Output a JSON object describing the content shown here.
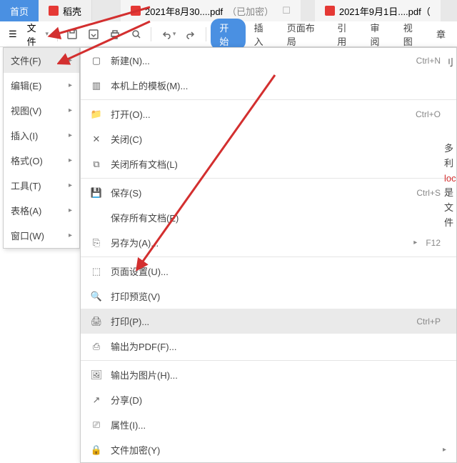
{
  "tabs": {
    "home": "首页",
    "dockshell": "稻壳",
    "pdf1": "2021年8月30....pdf",
    "pdf1_suffix": "（已加密）",
    "pdf2": "2021年9月1日....pdf（"
  },
  "toolbar": {
    "file": "文件",
    "start": "开始",
    "insert": "插入",
    "layout": "页面布局",
    "reference": "引用",
    "review": "审阅",
    "view": "视图",
    "chapter": "章"
  },
  "side": {
    "file": "文件(F)",
    "edit": "编辑(E)",
    "view": "视图(V)",
    "insert": "插入(I)",
    "format": "格式(O)",
    "tools": "工具(T)",
    "table": "表格(A)",
    "window": "窗口(W)"
  },
  "sub": {
    "new": "新建(N)...",
    "template": "本机上的模板(M)...",
    "open": "打开(O)...",
    "close": "关闭(C)",
    "close_all": "关闭所有文档(L)",
    "save": "保存(S)",
    "save_all": "保存所有文档(E)",
    "save_as": "另存为(A)...",
    "page_setup": "页面设置(U)...",
    "print_preview": "打印预览(V)",
    "print": "打印(P)...",
    "export_pdf": "输出为PDF(F)...",
    "export_img": "输出为图片(H)...",
    "share": "分享(D)",
    "properties": "属性(I)...",
    "encrypt": "文件加密(Y)"
  },
  "shortcuts": {
    "new": "Ctrl+N",
    "open": "Ctrl+O",
    "save": "Ctrl+S",
    "save_as": "F12",
    "print": "Ctrl+P"
  },
  "right_text": "刂\n\n多利\nloc\n是\n文件"
}
